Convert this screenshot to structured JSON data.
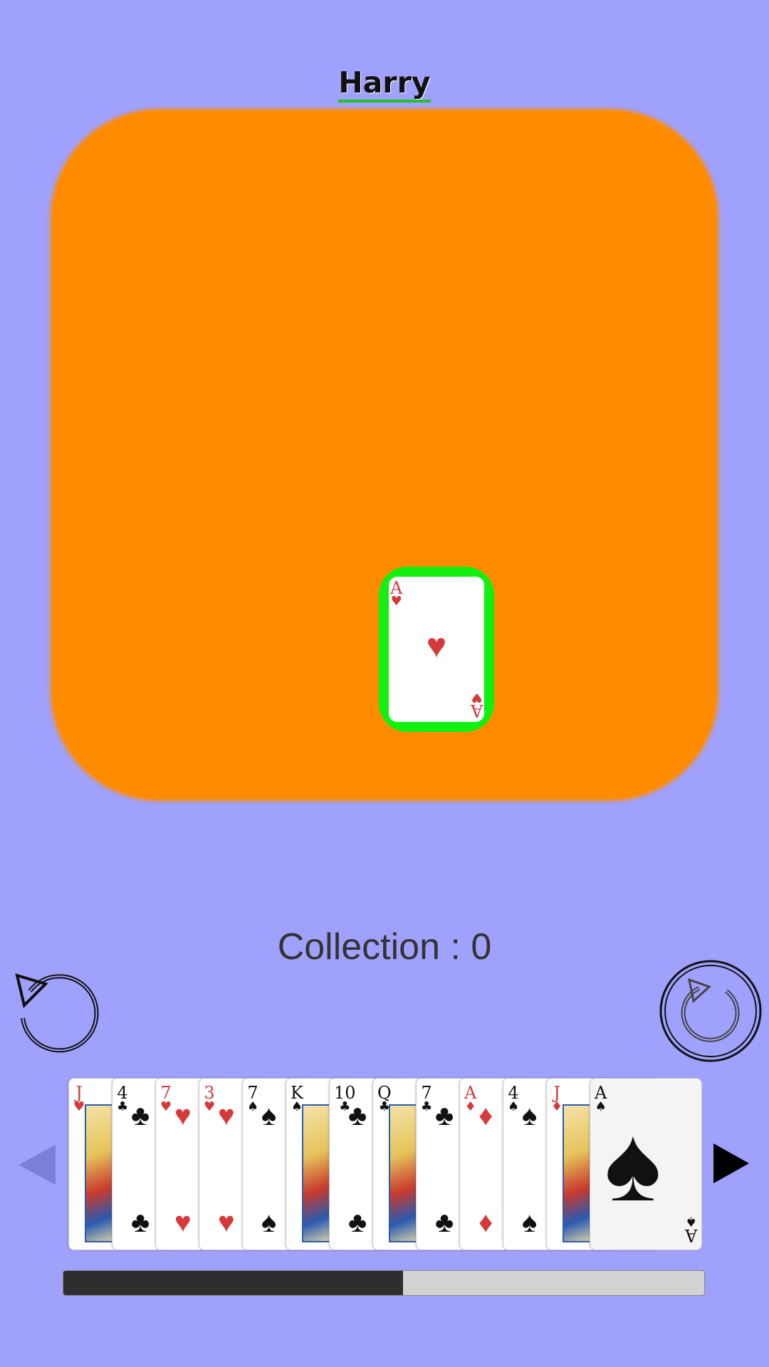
{
  "player": {
    "name": "Harry"
  },
  "table": {
    "color": "#ff8c00",
    "played_card": {
      "rank": "A",
      "suit": "♥",
      "color": "red",
      "highlight": "#11f011"
    }
  },
  "collection": {
    "label": "Collection : 0"
  },
  "controls": {
    "undo_icon": "undo-icon",
    "redo_icon": "redo-icon"
  },
  "hand": {
    "cards": [
      {
        "rank": "J",
        "suit": "♥",
        "color": "red",
        "court": true
      },
      {
        "rank": "4",
        "suit": "♣",
        "color": "black",
        "court": false
      },
      {
        "rank": "7",
        "suit": "♥",
        "color": "red",
        "court": false
      },
      {
        "rank": "3",
        "suit": "♥",
        "color": "red",
        "court": false
      },
      {
        "rank": "7",
        "suit": "♠",
        "color": "black",
        "court": false
      },
      {
        "rank": "K",
        "suit": "♠",
        "color": "black",
        "court": true
      },
      {
        "rank": "10",
        "suit": "♣",
        "color": "black",
        "court": false
      },
      {
        "rank": "Q",
        "suit": "♣",
        "color": "black",
        "court": true
      },
      {
        "rank": "7",
        "suit": "♣",
        "color": "black",
        "court": false
      },
      {
        "rank": "A",
        "suit": "♦",
        "color": "red",
        "court": false
      },
      {
        "rank": "4",
        "suit": "♠",
        "color": "black",
        "court": false
      },
      {
        "rank": "J",
        "suit": "♦",
        "color": "red",
        "court": true
      },
      {
        "rank": "A",
        "suit": "♠",
        "color": "black",
        "court": false
      }
    ],
    "scroll_position": 0.53
  },
  "colors": {
    "background": "#a0a0fd",
    "scroll_thumb": "#2e2e2e",
    "scroll_track": "#d3d3d3"
  }
}
